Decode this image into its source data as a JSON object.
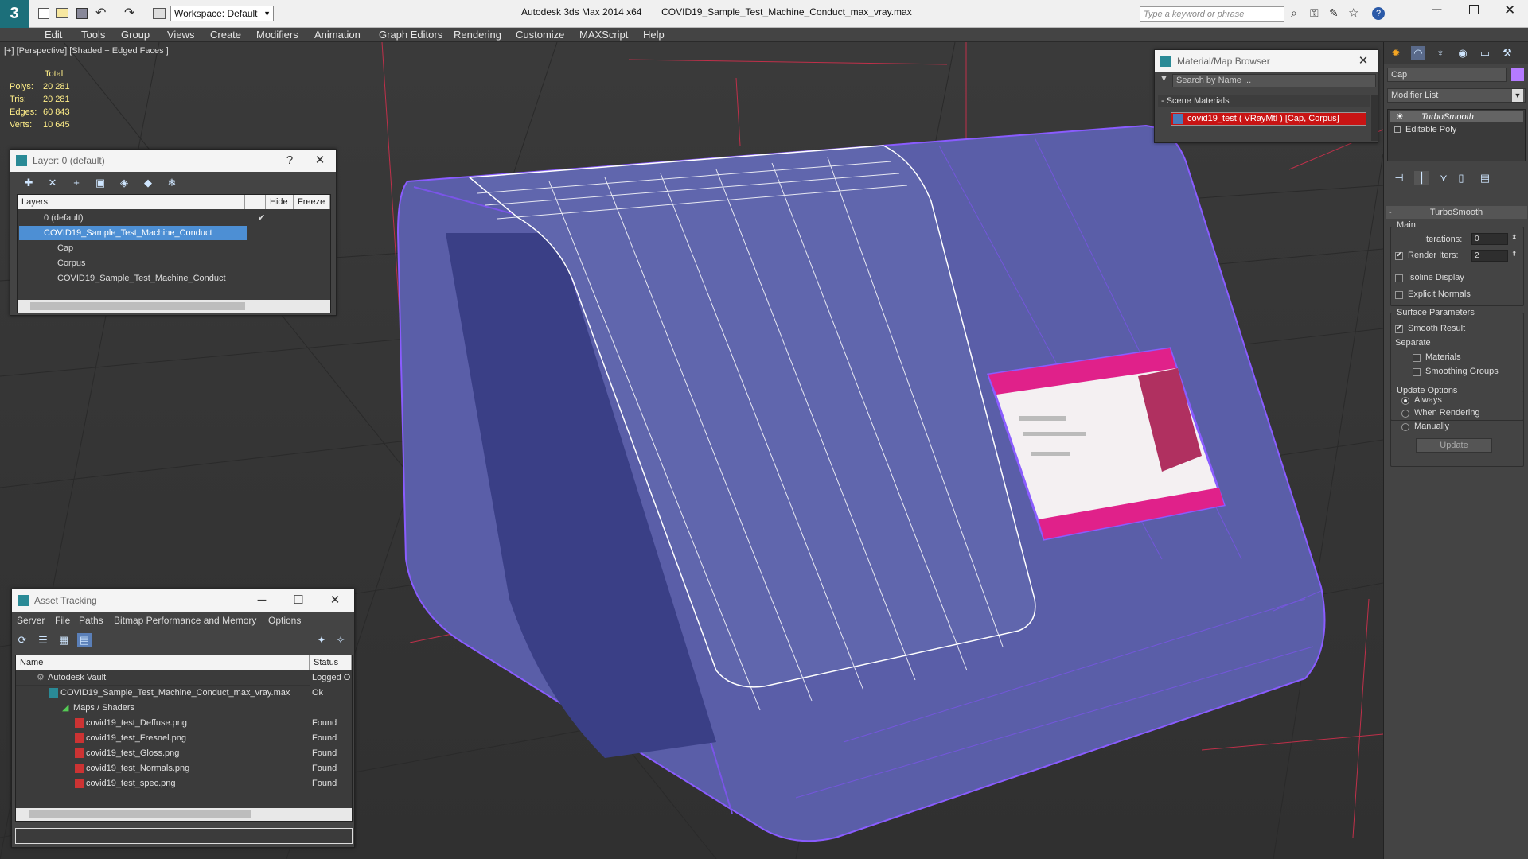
{
  "app": {
    "title": "Autodesk 3ds Max  2014 x64",
    "file": "COVID19_Sample_Test_Machine_Conduct_max_vray.max",
    "workspace": "Workspace: Default",
    "search_placeholder": "Type a keyword or phrase"
  },
  "menu": [
    "Edit",
    "Tools",
    "Group",
    "Views",
    "Create",
    "Modifiers",
    "Animation",
    "Graph Editors",
    "Rendering",
    "Customize",
    "MAXScript",
    "Help"
  ],
  "viewport": {
    "label": "[+] [Perspective] [Shaded + Edged Faces ]",
    "stats_header": "Total",
    "stats": [
      {
        "k": "Polys:",
        "v": "20 281"
      },
      {
        "k": "Tris:",
        "v": "20 281"
      },
      {
        "k": "Edges:",
        "v": "60 843"
      },
      {
        "k": "Verts:",
        "v": "10 645"
      }
    ]
  },
  "layer_dialog": {
    "title": "Layer: 0 (default)",
    "help": "?",
    "columns": [
      "Layers",
      "Hide",
      "Freeze"
    ],
    "rows": [
      {
        "name": "0 (default)"
      },
      {
        "name": "COVID19_Sample_Test_Machine_Conduct"
      },
      {
        "name": "Cap"
      },
      {
        "name": "Corpus"
      },
      {
        "name": "COVID19_Sample_Test_Machine_Conduct"
      }
    ]
  },
  "material_browser": {
    "title": "Material/Map Browser",
    "search_placeholder": "Search by Name ...",
    "section": "- Scene Materials",
    "item": "covid19_test  ( VRayMtl )  [Cap, Corpus]"
  },
  "command_panel": {
    "object_name": "Cap",
    "modifier_list": "Modifier List",
    "stack": [
      "TurboSmooth",
      "Editable Poly"
    ],
    "rollout_title": "TurboSmooth",
    "main_group": "Main",
    "iterations_label": "Iterations:",
    "iterations_value": "0",
    "render_iters_label": "Render Iters:",
    "render_iters_value": "2",
    "isoline": "Isoline Display",
    "explicit_normals": "Explicit Normals",
    "surface_group": "Surface Parameters",
    "smooth_result": "Smooth Result",
    "separate": "Separate",
    "materials": "Materials",
    "smoothing_groups": "Smoothing Groups",
    "update_group": "Update Options",
    "always": "Always",
    "when_rendering": "When Rendering",
    "manually": "Manually",
    "update_button": "Update"
  },
  "asset_tracking": {
    "title": "Asset Tracking",
    "menu": [
      "Server",
      "File",
      "Paths",
      "Bitmap Performance and Memory",
      "Options"
    ],
    "columns": [
      "Name",
      "Status"
    ],
    "rows": [
      {
        "name": "Autodesk Vault",
        "status": "Logged O"
      },
      {
        "name": "COVID19_Sample_Test_Machine_Conduct_max_vray.max",
        "status": "Ok"
      },
      {
        "name": "Maps / Shaders",
        "status": ""
      },
      {
        "name": "covid19_test_Deffuse.png",
        "status": "Found"
      },
      {
        "name": "covid19_test_Fresnel.png",
        "status": "Found"
      },
      {
        "name": "covid19_test_Gloss.png",
        "status": "Found"
      },
      {
        "name": "covid19_test_Normals.png",
        "status": "Found"
      },
      {
        "name": "covid19_test_spec.png",
        "status": "Found"
      }
    ]
  },
  "colors": {
    "selection": "#4d8fd4",
    "wire": "#8a5cff",
    "model": "#5a5ea8",
    "screen_accent": "#e0218a"
  }
}
